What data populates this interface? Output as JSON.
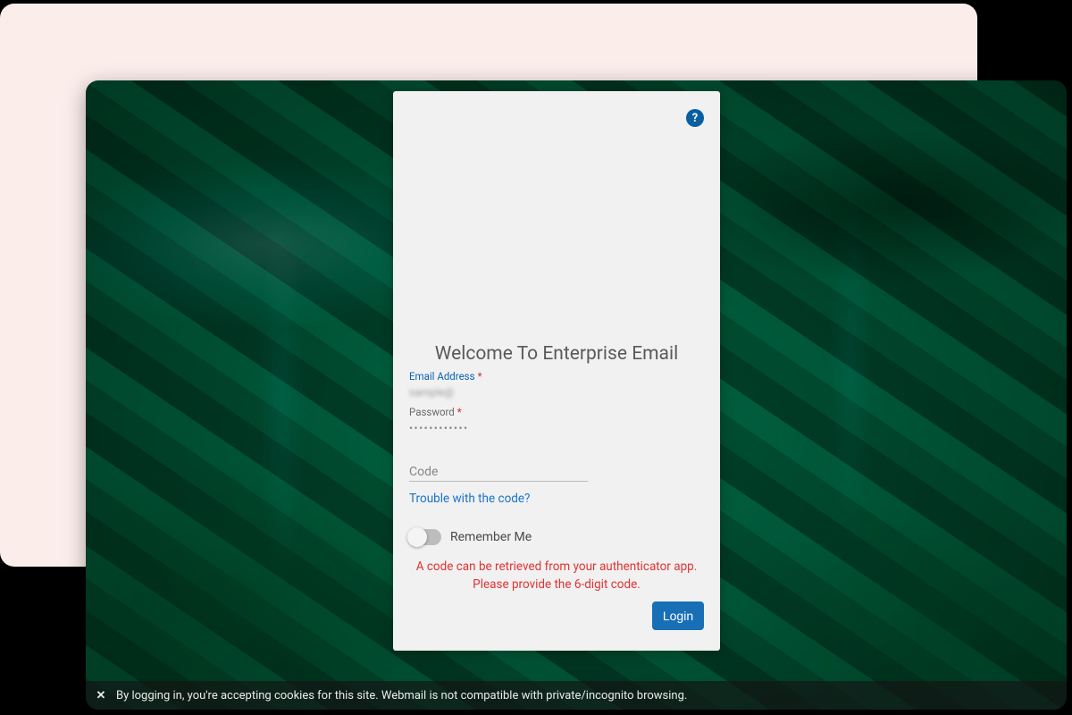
{
  "login": {
    "title": "Welcome To Enterprise Email",
    "email": {
      "label": "Email Address",
      "required_mark": "*",
      "value": "sample@"
    },
    "password": {
      "label": "Password",
      "required_mark": "*",
      "masked_value": "••••••••••••"
    },
    "code": {
      "label": "Code"
    },
    "trouble_link": "Trouble with the code?",
    "remember": {
      "label": "Remember Me"
    },
    "error": {
      "line1": "A code can be retrieved from your authenticator app.",
      "line2": "Please provide the 6-digit code."
    },
    "login_button": "Login",
    "help_icon": "?"
  },
  "cookie_bar": {
    "close": "✕",
    "text": "By logging in, you're accepting cookies for this site. Webmail is not compatible with private/incognito browsing."
  }
}
